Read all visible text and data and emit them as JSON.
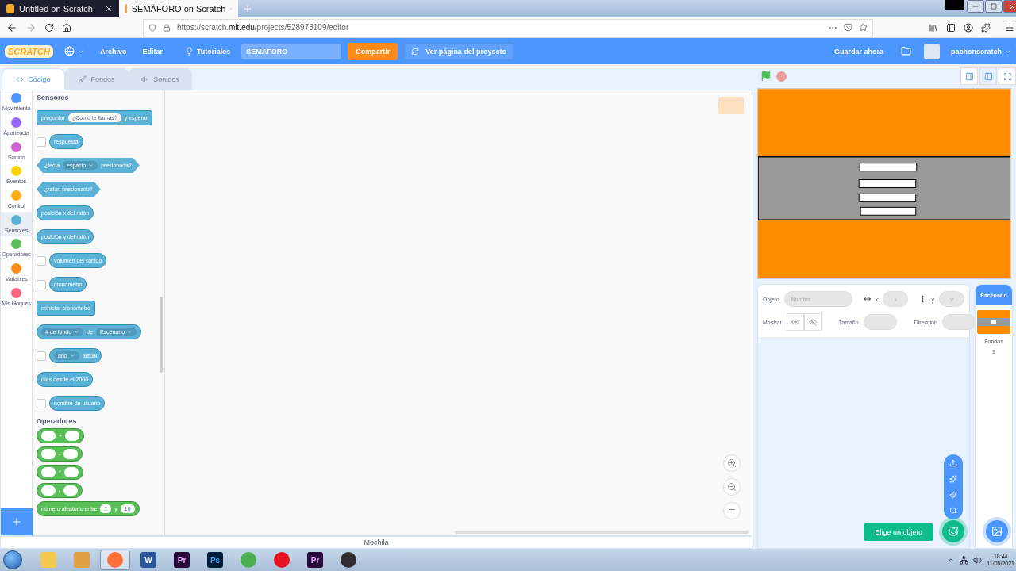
{
  "browser": {
    "tabs": [
      {
        "title": "Untitled on Scratch",
        "selected": false
      },
      {
        "title": "SEMÁFORO on Scratch",
        "selected": true
      }
    ],
    "url": "https://scratch.**mit.edu**/projects/528973109/editor"
  },
  "menubar": {
    "logo": "SCRATCH",
    "menus": [
      "Archivo",
      "Editar"
    ],
    "tutorials": "Tutoriales",
    "project_title": "SEMÁFORO",
    "share": "Compartir",
    "see_project": "Ver página del proyecto",
    "save": "Guardar ahora",
    "username": "pachonscratch"
  },
  "editor_tabs": [
    {
      "kind": "code",
      "label": "Código",
      "selected": true
    },
    {
      "kind": "costumes",
      "label": "Fondos",
      "selected": false
    },
    {
      "kind": "sounds",
      "label": "Sonidos",
      "selected": false
    }
  ],
  "categories": [
    {
      "label": "Movimiento",
      "color": "#4c97ff",
      "selected": false
    },
    {
      "label": "Apariencia",
      "color": "#9966ff",
      "selected": false
    },
    {
      "label": "Sonido",
      "color": "#cf63cf",
      "selected": false
    },
    {
      "label": "Eventos",
      "color": "#ffd500",
      "selected": false
    },
    {
      "label": "Control",
      "color": "#ffab19",
      "selected": false
    },
    {
      "label": "Sensores",
      "color": "#5cb1d6",
      "selected": true
    },
    {
      "label": "Operadores",
      "color": "#59c059",
      "selected": false
    },
    {
      "label": "Variables",
      "color": "#ff8c1a",
      "selected": false
    },
    {
      "label": "Mis bloques",
      "color": "#ff6680",
      "selected": false
    }
  ],
  "palette": [
    {
      "title": "Sensores",
      "color": "#5cb1d6",
      "blocks": [
        {
          "kind": "command",
          "parts": [
            {
              "kind": "text",
              "text": "preguntar"
            },
            {
              "kind": "input",
              "text": "¿Cómo te llamas?"
            },
            {
              "kind": "text",
              "text": "y esperar"
            }
          ]
        },
        {
          "kind": "reporter",
          "checked": false,
          "parts": [
            {
              "kind": "text",
              "text": "respuesta"
            }
          ]
        },
        {
          "kind": "boolean",
          "parts": [
            {
              "kind": "text",
              "text": "¿tecla"
            },
            {
              "kind": "dropdown",
              "text": "espacio"
            },
            {
              "kind": "text",
              "text": "presionada?"
            }
          ]
        },
        {
          "kind": "boolean",
          "parts": [
            {
              "kind": "text",
              "text": "¿ratón presionado?"
            }
          ]
        },
        {
          "kind": "reporter",
          "parts": [
            {
              "kind": "text",
              "text": "posición x del ratón"
            }
          ]
        },
        {
          "kind": "reporter",
          "parts": [
            {
              "kind": "text",
              "text": "posición y del ratón"
            }
          ]
        },
        {
          "kind": "reporter",
          "checked": false,
          "parts": [
            {
              "kind": "text",
              "text": "volumen del sonido"
            }
          ]
        },
        {
          "kind": "reporter",
          "checked": false,
          "parts": [
            {
              "kind": "text",
              "text": "cronómetro"
            }
          ]
        },
        {
          "kind": "command",
          "parts": [
            {
              "kind": "text",
              "text": "reiniciar cronómetro"
            }
          ]
        },
        {
          "kind": "reporter",
          "parts": [
            {
              "kind": "dropdown",
              "text": "# de fondo"
            },
            {
              "kind": "text",
              "text": "de"
            },
            {
              "kind": "dropdown",
              "text": "Escenario"
            }
          ]
        },
        {
          "kind": "reporter",
          "checked": false,
          "parts": [
            {
              "kind": "dropdown",
              "text": "año"
            },
            {
              "kind": "text",
              "text": "actual"
            }
          ]
        },
        {
          "kind": "reporter",
          "parts": [
            {
              "kind": "text",
              "text": "días desde el 2000"
            }
          ]
        },
        {
          "kind": "reporter",
          "checked": false,
          "parts": [
            {
              "kind": "text",
              "text": "nombre de usuario"
            }
          ]
        }
      ]
    },
    {
      "title": "Operadores",
      "color": "#59c059",
      "blocks": [
        {
          "kind": "reporter",
          "parts": [
            {
              "kind": "slot"
            },
            {
              "kind": "text",
              "text": "+"
            },
            {
              "kind": "slot"
            }
          ]
        },
        {
          "kind": "reporter",
          "parts": [
            {
              "kind": "slot"
            },
            {
              "kind": "text",
              "text": "-"
            },
            {
              "kind": "slot"
            }
          ]
        },
        {
          "kind": "reporter",
          "parts": [
            {
              "kind": "slot"
            },
            {
              "kind": "text",
              "text": "*"
            },
            {
              "kind": "slot"
            }
          ]
        },
        {
          "kind": "reporter",
          "parts": [
            {
              "kind": "slot"
            },
            {
              "kind": "text",
              "text": "/"
            },
            {
              "kind": "slot"
            }
          ]
        },
        {
          "kind": "reporter",
          "parts": [
            {
              "kind": "text",
              "text": "número aleatorio entre"
            },
            {
              "kind": "input",
              "text": "1"
            },
            {
              "kind": "text",
              "text": "y"
            },
            {
              "kind": "input",
              "text": "10"
            }
          ]
        }
      ]
    }
  ],
  "backpack": "Mochila",
  "sprite_info": {
    "sprite_label": "Objeto",
    "name_placeholder": "Nombre",
    "x_label": "x",
    "x_placeholder": "x",
    "y_label": "y",
    "y_placeholder": "y",
    "show_label": "Mostrar",
    "size_label": "Tamaño",
    "direction_label": "Dirección"
  },
  "stage_target": {
    "title": "Escenario",
    "backdrops_label": "Fondos",
    "backdrop_count": "1"
  },
  "sprite_tooltip": "Elige un objeto",
  "taskbar": {
    "apps": [
      {
        "kind": "folder",
        "selected": false
      },
      {
        "kind": "media",
        "selected": false
      },
      {
        "kind": "firefox",
        "selected": true
      },
      {
        "kind": "word",
        "label": "W",
        "selected": false
      },
      {
        "kind": "premiere",
        "label": "Pr",
        "selected": false
      },
      {
        "kind": "photoshop",
        "label": "Ps",
        "selected": false
      },
      {
        "kind": "chrome",
        "selected": false
      },
      {
        "kind": "opera",
        "selected": false
      },
      {
        "kind": "premiere",
        "label": "Pr",
        "selected": false
      },
      {
        "kind": "obs",
        "selected": false
      }
    ],
    "time": "18:44",
    "date": "11/05/2021"
  }
}
